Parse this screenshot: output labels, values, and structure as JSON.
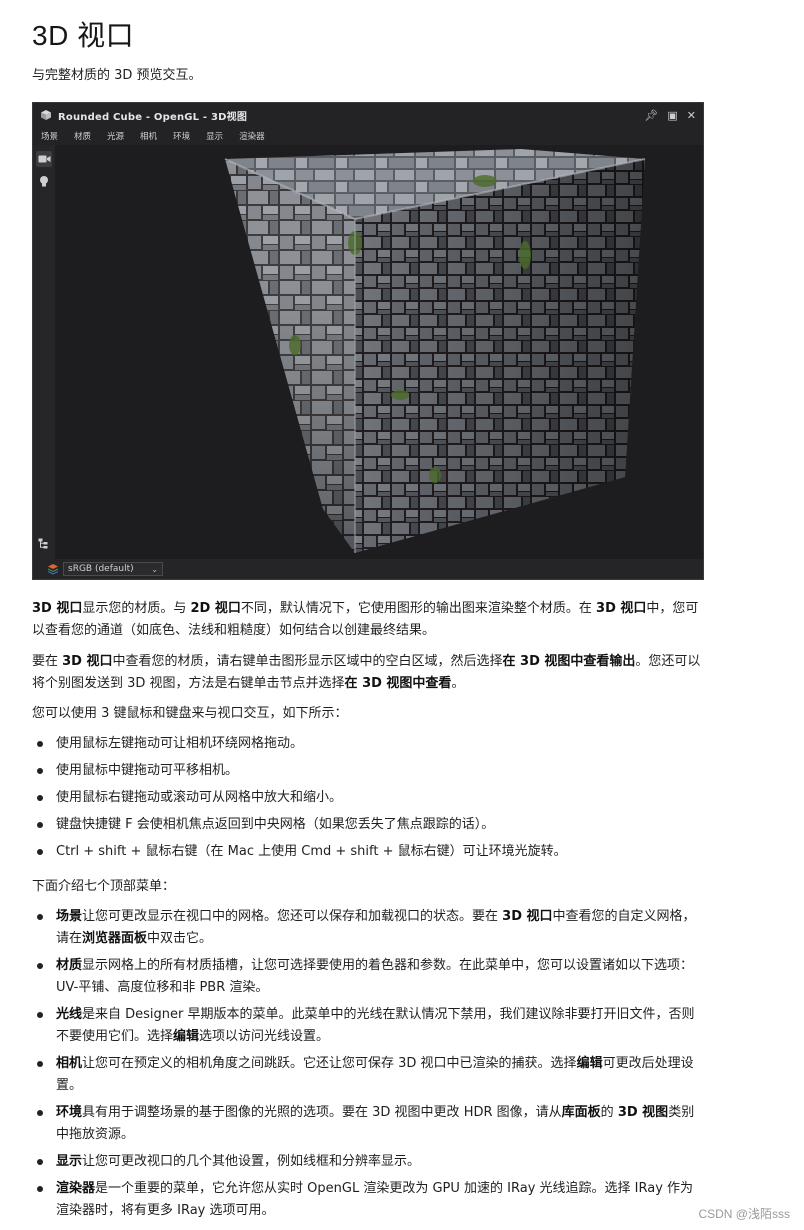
{
  "heading": "3D 视口",
  "subtitle": "与完整材质的 3D 预览交互。",
  "app": {
    "window_title": "Rounded Cube - OpenGL - 3D视图",
    "menu": [
      "场景",
      "材质",
      "光源",
      "相机",
      "环境",
      "显示",
      "渲染器"
    ],
    "colorspace": "sRGB (default)",
    "colors": {
      "window_bg": "#1b1b1d",
      "chrome": "#232326",
      "stone": "#6b7280",
      "moss": "#4b6b2a"
    }
  },
  "paragraphs": {
    "p1": [
      "3D 视口",
      "显示您的材质。与 ",
      "2D 视口",
      "不同，默认情况下，它使用图形的输出图来渲染整个材质。在 ",
      "3D 视口",
      "中，您可以查看您的通道（如底色、法线和粗糙度）如何结合以创建最终结果。"
    ],
    "p2": [
      "要在 ",
      "3D 视口",
      "中查看您的材质，请右键单击图形显示区域中的空白区域，然后选择",
      "在 3D 视图中查看输出",
      "。您还可以将个别图发送到 3D 视图，方法是右键单击节点并选择",
      "在 3D 视图中查看",
      "。"
    ],
    "p3": "您可以使用 3 键鼠标和键盘来与视口交互，如下所示：",
    "p4": "下面介绍七个顶部菜单："
  },
  "controls_list": [
    "使用鼠标左键拖动可让相机环绕网格拖动。",
    "使用鼠标中键拖动可平移相机。",
    "使用鼠标右键拖动或滚动可从网格中放大和缩小。",
    "键盘快捷键 F 会使相机焦点返回到中央网格（如果您丢失了焦点跟踪的话）。",
    "Ctrl + shift + 鼠标右键（在 Mac 上使用 Cmd + shift + 鼠标右键）可让环境光旋转。"
  ],
  "menus_list": [
    {
      "b1": "场景",
      "t1": "让您可更改显示在视口中的网格。您还可以保存和加载视口的状态。要在 ",
      "b2": "3D 视口",
      "t2": "中查看您的自定义网格，请在",
      "b3": "浏览器面板",
      "t3": "中双击它。"
    },
    {
      "b1": "材质",
      "t1": "显示网格上的所有材质插槽，让您可选择要使用的着色器和参数。在此菜单中，您可以设置诸如以下选项：UV-平铺、高度位移和非 PBR 渲染。",
      "b2": "",
      "t2": "",
      "b3": "",
      "t3": ""
    },
    {
      "b1": "光线",
      "t1": "是来自 Designer 早期版本的菜单。此菜单中的光线在默认情况下禁用，我们建议除非要打开旧文件，否则不要使用它们。选择",
      "b2": "编辑",
      "t2": "选项以访问光线设置。",
      "b3": "",
      "t3": ""
    },
    {
      "b1": "相机",
      "t1": "让您可在预定义的相机角度之间跳跃。它还让您可保存 3D 视口中已渲染的捕获。选择",
      "b2": "编辑",
      "t2": "可更改后处理设置。",
      "b3": "",
      "t3": ""
    },
    {
      "b1": "环境",
      "t1": "具有用于调整场景的基于图像的光照的选项。要在 3D 视图中更改 HDR 图像，请从",
      "b2": "库面板",
      "t2": "的 ",
      "b3": "3D 视图",
      "t3": "类别中拖放资源。"
    },
    {
      "b1": "显示",
      "t1": "让您可更改视口的几个其他设置，例如线框和分辨率显示。",
      "b2": "",
      "t2": "",
      "b3": "",
      "t3": ""
    },
    {
      "b1": "渲染器",
      "t1": "是一个重要的菜单，它允许您从实时 OpenGL 渲染更改为 GPU 加速的 IRay 光线追踪。选择 IRay 作为渲染器时，将有更多 IRay 选项可用。",
      "b2": "",
      "t2": "",
      "b3": "",
      "t3": ""
    }
  ],
  "watermark": "CSDN @浅陌sss"
}
